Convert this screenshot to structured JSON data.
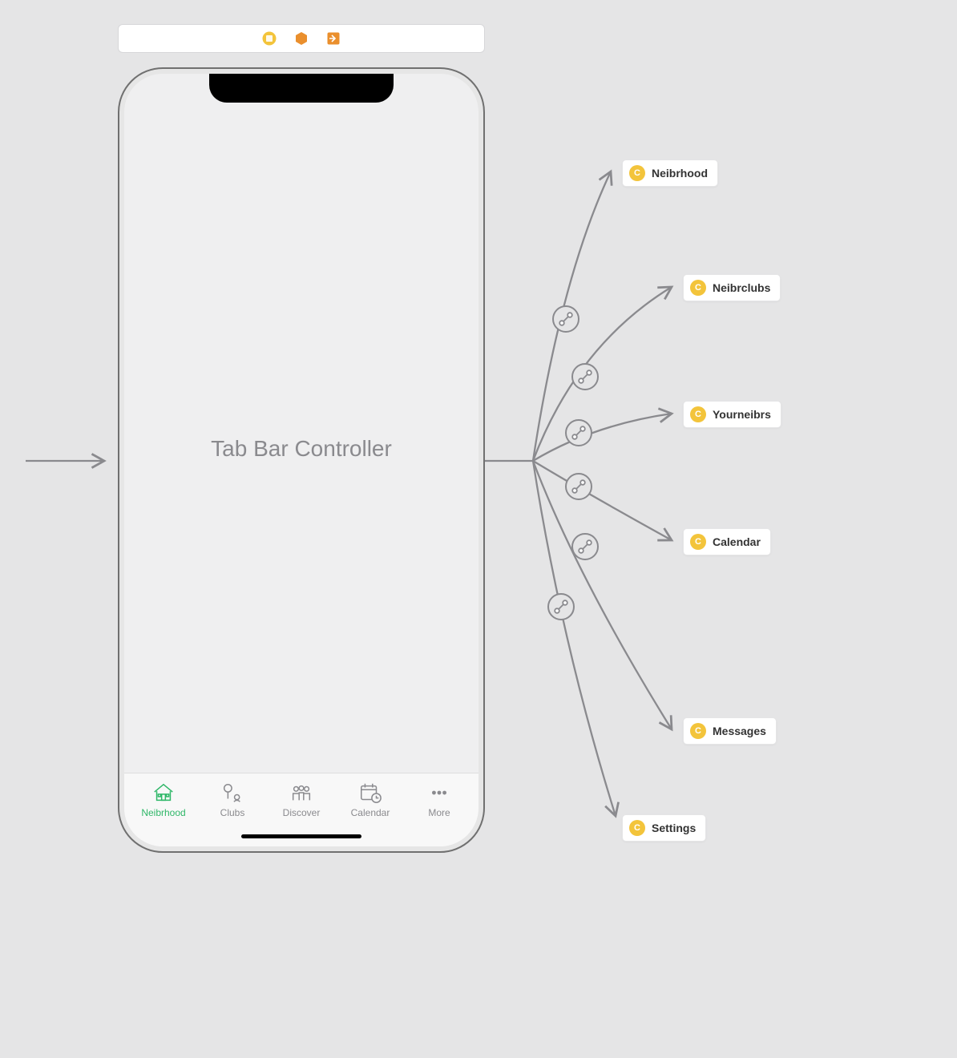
{
  "screen_title": "Tab Bar Controller",
  "tabs": [
    {
      "label": "Neibrhood",
      "icon": "house-icon",
      "active": true
    },
    {
      "label": "Clubs",
      "icon": "tree-people-icon",
      "active": false
    },
    {
      "label": "Discover",
      "icon": "people-group-icon",
      "active": false
    },
    {
      "label": "Calendar",
      "icon": "calendar-clock-icon",
      "active": false
    },
    {
      "label": "More",
      "icon": "ellipsis-icon",
      "active": false
    }
  ],
  "destinations": [
    {
      "label": "Neibrhood"
    },
    {
      "label": "Neibrclubs"
    },
    {
      "label": "Yourneibrs"
    },
    {
      "label": "Calendar"
    },
    {
      "label": "Messages"
    },
    {
      "label": "Settings"
    }
  ],
  "dest_glyph": "C",
  "colors": {
    "active": "#2fb768",
    "inactive": "#8a8a8e",
    "chip_circle": "#f3c43b",
    "background": "#e5e5e6"
  }
}
